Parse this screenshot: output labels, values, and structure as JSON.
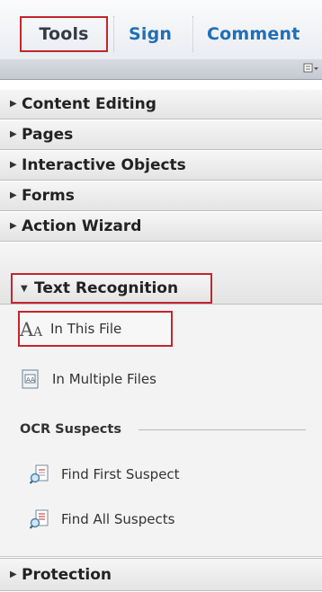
{
  "tabs": [
    {
      "label": "Tools",
      "selected": true
    },
    {
      "label": "Sign",
      "selected": false
    },
    {
      "label": "Comment",
      "selected": false
    }
  ],
  "options_icon": "options-menu-icon",
  "panels": [
    {
      "label": "Content Editing",
      "expanded": false
    },
    {
      "label": "Pages",
      "expanded": false
    },
    {
      "label": "Interactive Objects",
      "expanded": false
    },
    {
      "label": "Forms",
      "expanded": false
    },
    {
      "label": "Action Wizard",
      "expanded": false
    },
    {
      "label": "Text Recognition",
      "expanded": true
    },
    {
      "label": "Protection",
      "expanded": false
    }
  ],
  "text_recognition": {
    "tools": [
      {
        "label": "In This File",
        "icon": "text-aa-icon",
        "highlighted": true
      },
      {
        "label": "In Multiple Files",
        "icon": "multiple-files-icon",
        "highlighted": false
      }
    ],
    "ocr_suspects": {
      "heading": "OCR Suspects",
      "tools": [
        {
          "label": "Find First Suspect",
          "icon": "find-suspect-icon"
        },
        {
          "label": "Find All Suspects",
          "icon": "find-all-suspects-icon"
        }
      ]
    }
  },
  "colors": {
    "highlight_border": "#c3262d",
    "tab_link": "#1f6fb6"
  }
}
